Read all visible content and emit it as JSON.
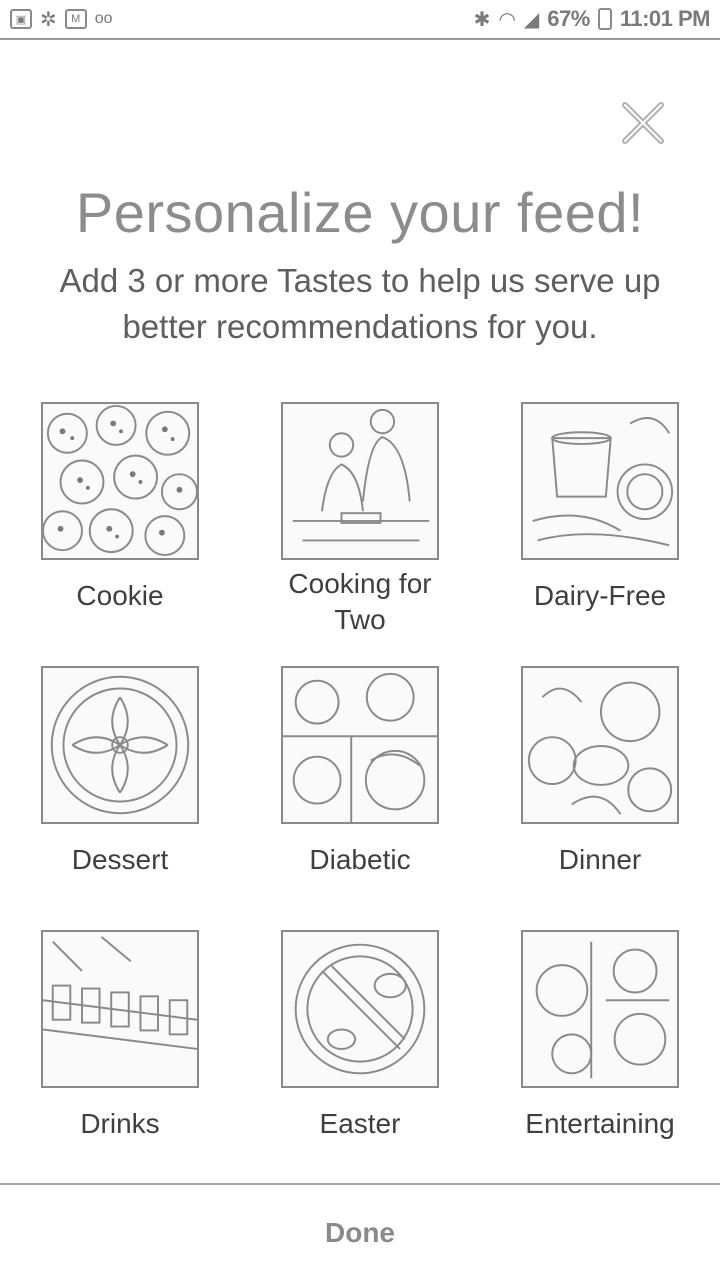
{
  "status_bar": {
    "left_icons": [
      "photo-icon",
      "pinwheel-icon",
      "gmail-icon",
      "voicemail-icon"
    ],
    "battery": "67%",
    "time": "11:01 PM"
  },
  "header": {
    "title": "Personalize your feed!",
    "subtitle": "Add 3 or more Tastes to help us serve up better recommendations for you."
  },
  "tastes": [
    {
      "label": "Cookie"
    },
    {
      "label": "Cooking for Two"
    },
    {
      "label": "Dairy-Free"
    },
    {
      "label": "Dessert"
    },
    {
      "label": "Diabetic"
    },
    {
      "label": "Dinner"
    },
    {
      "label": "Drinks"
    },
    {
      "label": "Easter"
    },
    {
      "label": "Entertaining"
    }
  ],
  "footer": {
    "done_label": "Done"
  }
}
